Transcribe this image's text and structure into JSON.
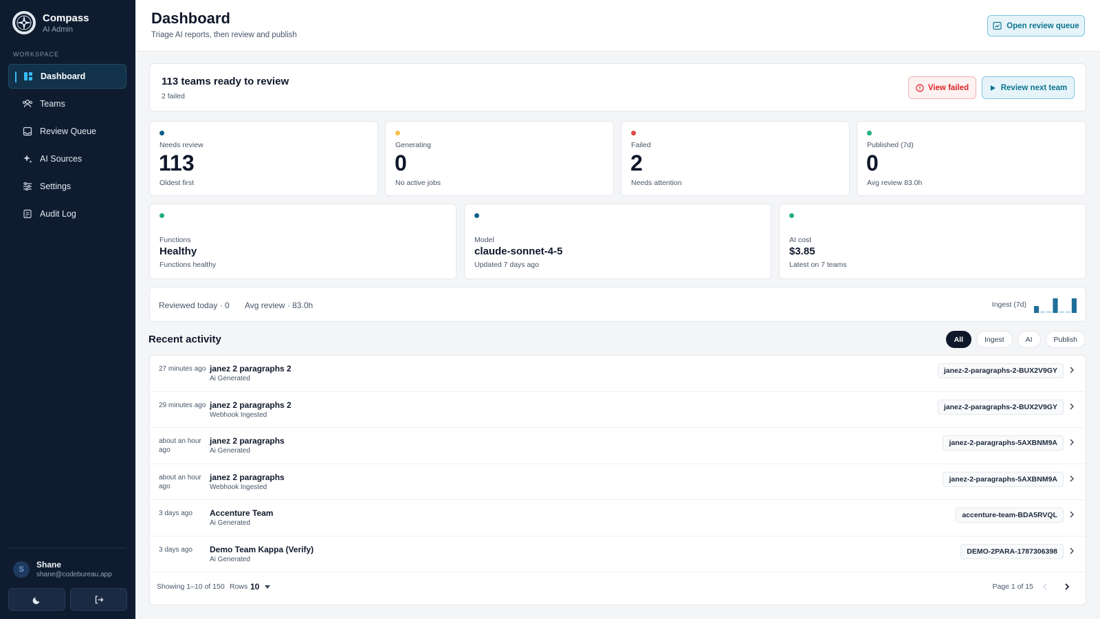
{
  "brand": {
    "name": "Compass",
    "subtitle": "AI Admin"
  },
  "sidebar": {
    "section": "WORKSPACE",
    "items": [
      {
        "label": "Dashboard",
        "icon": "grid-icon",
        "active": true
      },
      {
        "label": "Teams",
        "icon": "users-icon"
      },
      {
        "label": "Review Queue",
        "icon": "inbox-icon"
      },
      {
        "label": "AI Sources",
        "icon": "sparkles-icon"
      },
      {
        "label": "Settings",
        "icon": "sliders-icon"
      },
      {
        "label": "Audit Log",
        "icon": "history-icon"
      }
    ],
    "user": {
      "initial": "S",
      "name": "Shane",
      "email": "shane@codebureau.app"
    }
  },
  "header": {
    "title": "Dashboard",
    "subtitle": "Triage AI reports, then review and publish",
    "open_queue": "Open review queue"
  },
  "ready": {
    "title": "113 teams ready to review",
    "sub": "2 failed",
    "view_failed": "View failed",
    "review_next": "Review next team"
  },
  "stats": [
    {
      "label": "Needs review",
      "value": "113",
      "foot": "Oldest first",
      "color": "#0e5f8a"
    },
    {
      "label": "Generating",
      "value": "0",
      "foot": "No active jobs",
      "color": "#f5c04a"
    },
    {
      "label": "Failed",
      "value": "2",
      "foot": "Needs attention",
      "color": "#e04848"
    },
    {
      "label": "Published (7d)",
      "value": "0",
      "foot": "Avg review 83.0h",
      "color": "#22b07d"
    }
  ],
  "info": [
    {
      "label": "Functions",
      "value": "Healthy",
      "foot": "Functions healthy",
      "color": "#22b07d"
    },
    {
      "label": "Model",
      "value": "claude-sonnet-4-5",
      "foot": "Updated 7 days ago",
      "color": "#0e5f8a"
    },
    {
      "label": "AI cost",
      "value": "$3.85",
      "foot": "Latest on 7 teams",
      "color": "#22b07d"
    }
  ],
  "summary": {
    "reviewed_today": "Reviewed today · 0",
    "avg_review": "Avg review · 83.0h",
    "ingest_label": "Ingest (7d)",
    "ingest_values": [
      0.4,
      0.1,
      0.1,
      0.85,
      0.1,
      0.1,
      0.85
    ]
  },
  "activity": {
    "title": "Recent activity",
    "filters": [
      "All",
      "Ingest",
      "AI",
      "Publish"
    ],
    "active_filter": "All",
    "rows": [
      {
        "time": "27 minutes ago",
        "title": "janez 2 paragraphs 2",
        "sub": "Ai Generated",
        "tag": "janez-2-paragraphs-2-BUX2V9GY"
      },
      {
        "time": "29 minutes ago",
        "title": "janez 2 paragraphs 2",
        "sub": "Webhook Ingested",
        "tag": "janez-2-paragraphs-2-BUX2V9GY"
      },
      {
        "time": "about an hour ago",
        "title": "janez 2 paragraphs",
        "sub": "Ai Generated",
        "tag": "janez-2-paragraphs-5AXBNM9A"
      },
      {
        "time": "about an hour ago",
        "title": "janez 2 paragraphs",
        "sub": "Webhook Ingested",
        "tag": "janez-2-paragraphs-5AXBNM9A"
      },
      {
        "time": "3 days ago",
        "title": "Accenture Team",
        "sub": "Ai Generated",
        "tag": "accenture-team-BDA5RVQL"
      },
      {
        "time": "3 days ago",
        "title": "Demo Team Kappa (Verify)",
        "sub": "Ai Generated",
        "tag": "DEMO-2PARA-1787306398"
      }
    ],
    "showing": "Showing 1–10 of 150",
    "rows_label": "Rows",
    "rows_value": "10",
    "page": "Page 1 of 15"
  }
}
